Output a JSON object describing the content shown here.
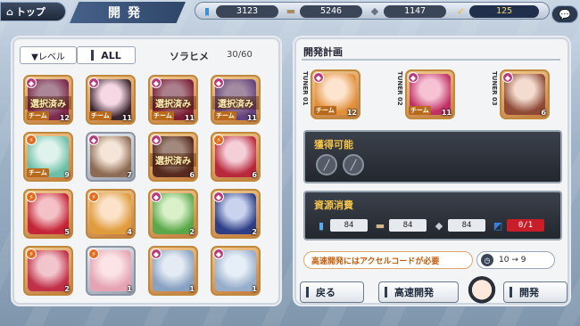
{
  "topbar": {
    "home_label": "トップ",
    "title": "開発",
    "resources": [
      {
        "icon": "fuel-icon",
        "value": "3123"
      },
      {
        "icon": "steel-icon",
        "value": "5246"
      },
      {
        "icon": "parts-icon",
        "value": "1147"
      },
      {
        "icon": "accel-code-icon",
        "value": "125"
      }
    ]
  },
  "left_panel": {
    "level_label": "▼レベル",
    "all_label": "ALL",
    "name_label": "ソラヒメ",
    "count": "30/60",
    "cards": [
      {
        "badge": "star",
        "selected": "選択済み",
        "team": "チーム",
        "level": "12",
        "colors": [
          "#f4c0d8",
          "#b33a6e"
        ]
      },
      {
        "badge": "star",
        "selected": "",
        "team": "チーム",
        "level": "11",
        "colors": [
          "#f6d8e4",
          "#3b2630"
        ]
      },
      {
        "badge": "star",
        "selected": "選択済み",
        "team": "チーム",
        "level": "11",
        "colors": [
          "#f3b7c8",
          "#b22b4c"
        ]
      },
      {
        "badge": "star",
        "selected": "選択済み",
        "team": "チーム",
        "level": "11",
        "colors": [
          "#e9c7e8",
          "#8f5fb2"
        ]
      },
      {
        "badge": "fire",
        "selected": "",
        "team": "チーム",
        "level": "9",
        "colors": [
          "#dff3ec",
          "#6bbfa8"
        ]
      },
      {
        "badge": "star",
        "selected": "",
        "team": "",
        "level": "7",
        "colors": [
          "#f5e5d8",
          "#8e6c54"
        ]
      },
      {
        "badge": "star",
        "selected": "選択済み",
        "team": "",
        "level": "6",
        "colors": [
          "#e9c4b3",
          "#7b3a2a"
        ]
      },
      {
        "badge": "fire",
        "selected": "",
        "team": "",
        "level": "6",
        "colors": [
          "#f5cfd8",
          "#b8283c"
        ]
      },
      {
        "badge": "fire",
        "selected": "",
        "team": "",
        "level": "5",
        "colors": [
          "#f4c2c6",
          "#c42638"
        ]
      },
      {
        "badge": "fire",
        "selected": "",
        "team": "",
        "level": "4",
        "colors": [
          "#fbe2c8",
          "#e09b3a"
        ]
      },
      {
        "badge": "star",
        "selected": "",
        "team": "",
        "level": "2",
        "colors": [
          "#d9f0c9",
          "#5ba84a"
        ]
      },
      {
        "badge": "star",
        "selected": "",
        "team": "",
        "level": "2",
        "colors": [
          "#c9d3ee",
          "#2d3e86"
        ]
      },
      {
        "badge": "fire",
        "selected": "",
        "team": "",
        "level": "2",
        "colors": [
          "#f2c4cb",
          "#c03048"
        ]
      },
      {
        "badge": "fire",
        "selected": "",
        "team": "",
        "level": "1",
        "colors": [
          "#fbe3e6",
          "#e5a3b3"
        ]
      },
      {
        "badge": "star",
        "selected": "",
        "team": "",
        "level": "1",
        "colors": [
          "#e4ebf4",
          "#8aa2c2"
        ]
      },
      {
        "badge": "star",
        "selected": "",
        "team": "",
        "level": "1",
        "colors": [
          "#e6eef7",
          "#97aecb"
        ]
      }
    ]
  },
  "right_panel": {
    "title": "開発計画",
    "tuners": [
      {
        "label": "TUNER 01",
        "badge": "star",
        "team": "チーム",
        "level": "12",
        "colors": [
          "#fde4cf",
          "#e38f3a"
        ]
      },
      {
        "label": "TUNER 02",
        "badge": "star",
        "team": "チーム",
        "level": "11",
        "colors": [
          "#f6c2d4",
          "#c02f63"
        ]
      },
      {
        "label": "TUNER 03",
        "badge": "star",
        "team": "",
        "level": "6",
        "colors": [
          "#f3dccf",
          "#8f4a36"
        ]
      }
    ],
    "acquire_title": "獲得可能",
    "cost_title": "資源消費",
    "costs": [
      {
        "icon": "fuel-icon",
        "value": "84"
      },
      {
        "icon": "steel-icon",
        "value": "84"
      },
      {
        "icon": "parts-icon",
        "value": "84"
      },
      {
        "icon": "accel-code-icon",
        "value": "0/1"
      }
    ],
    "fast_message": "高速開発にはアクセルコードが必要",
    "fast_time": "10 → 9",
    "back_label": "戻る",
    "fastdev_label": "高速開発",
    "dev_label": "開発"
  }
}
